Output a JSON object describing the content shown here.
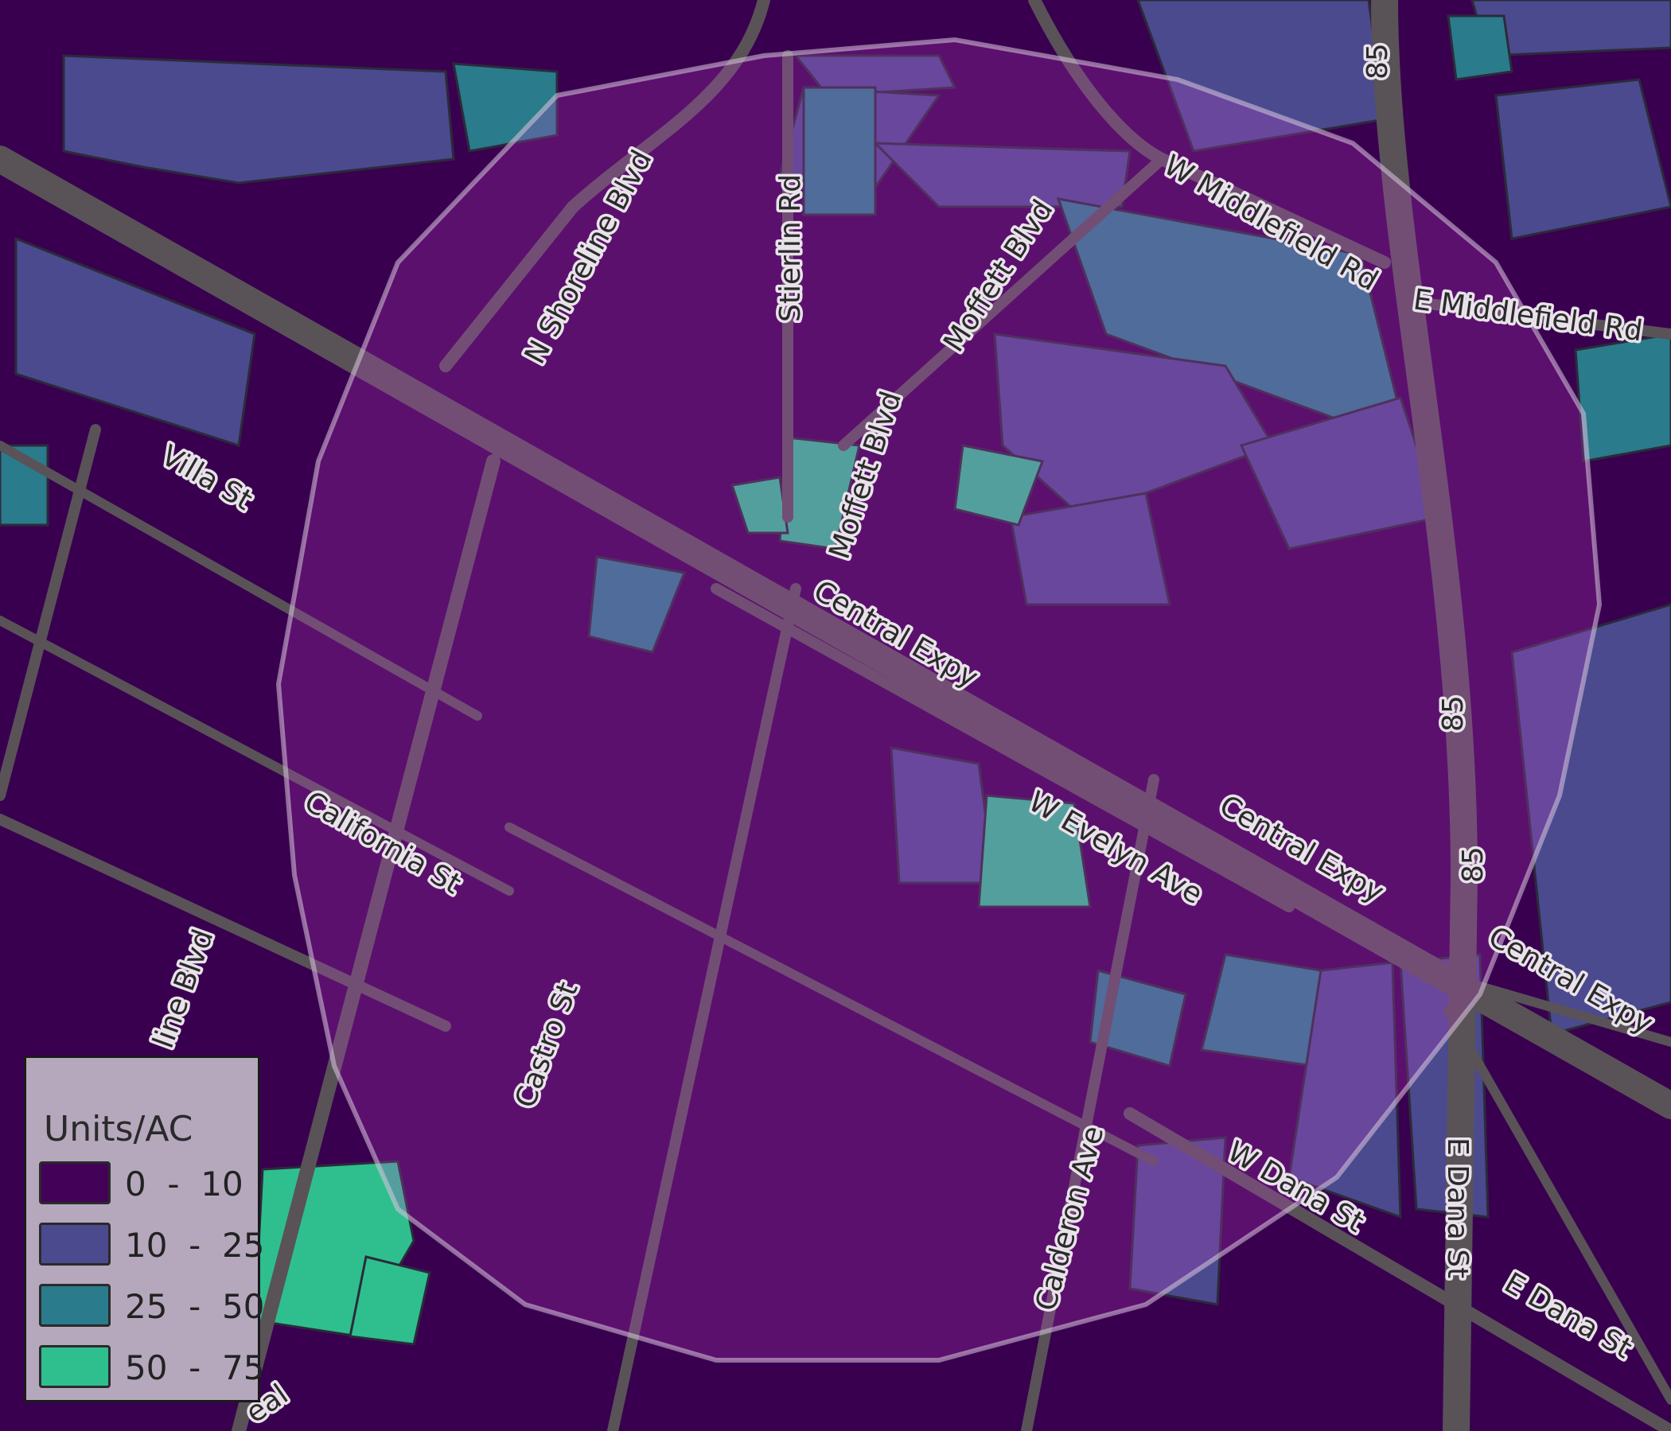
{
  "map": {
    "colors": {
      "background": "#3a0050",
      "road": "#595358",
      "parcel_outline": "#2b2b3a",
      "buffer_fill": "#c040c8",
      "buffer_outline": "#d8c8dc"
    },
    "road_labels": [
      "N Shoreline Blvd",
      "Stierlin Rd",
      "Moffett Blvd",
      "Moffett Blvd",
      "W Middlefield Rd",
      "E Middlefield Rd",
      "85",
      "85",
      "85",
      "Villa St",
      "Central Expy",
      "Central Expy",
      "Central Expy",
      "W Evelyn Ave",
      "California St",
      "Castro St",
      "Calderon Ave",
      "W Dana St",
      "E Dana St",
      "E Dana St",
      "line Blvd",
      "eal"
    ]
  },
  "legend": {
    "title": "Units/AC",
    "classes": [
      {
        "label": "0  -  10",
        "color": "#430158"
      },
      {
        "label": "10  -  25",
        "color": "#4b4a8f"
      },
      {
        "label": "25  -  50",
        "color": "#2a7b8c"
      },
      {
        "label": "50  -  75",
        "color": "#2fbf8f"
      }
    ]
  }
}
